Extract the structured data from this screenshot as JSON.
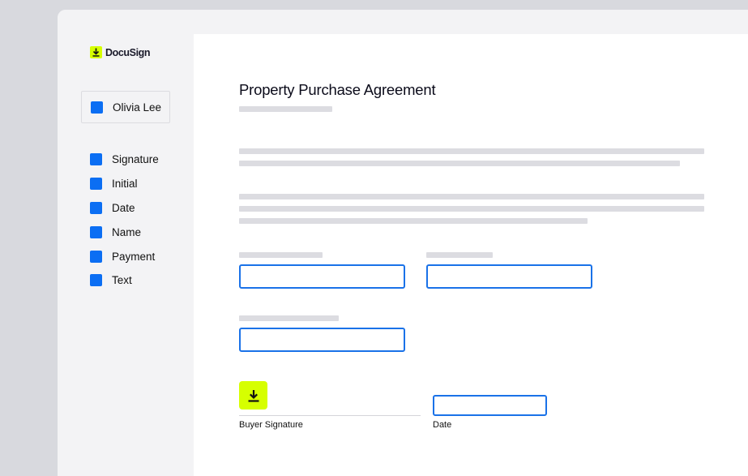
{
  "brand": {
    "name": "DocuSign",
    "accent": "#d6ff00",
    "field_color": "#0b6ef3"
  },
  "sidebar": {
    "signer": {
      "name": "Olivia Lee",
      "color": "#0b6ef3"
    },
    "fields": [
      {
        "label": "Signature",
        "icon": "signature-field-swatch"
      },
      {
        "label": "Initial",
        "icon": "initial-field-swatch"
      },
      {
        "label": "Date",
        "icon": "date-field-swatch"
      },
      {
        "label": "Name",
        "icon": "name-field-swatch"
      },
      {
        "label": "Payment",
        "icon": "payment-field-swatch"
      },
      {
        "label": "Text",
        "icon": "text-field-swatch"
      }
    ]
  },
  "document": {
    "title": "Property Purchase Agreement",
    "inputs": [
      {
        "value": "",
        "placeholder": ""
      },
      {
        "value": "",
        "placeholder": ""
      },
      {
        "value": "",
        "placeholder": ""
      }
    ],
    "signature": {
      "tag_icon": "download-arrow-icon",
      "label": "Buyer Signature"
    },
    "date": {
      "value": "",
      "label": "Date"
    }
  }
}
